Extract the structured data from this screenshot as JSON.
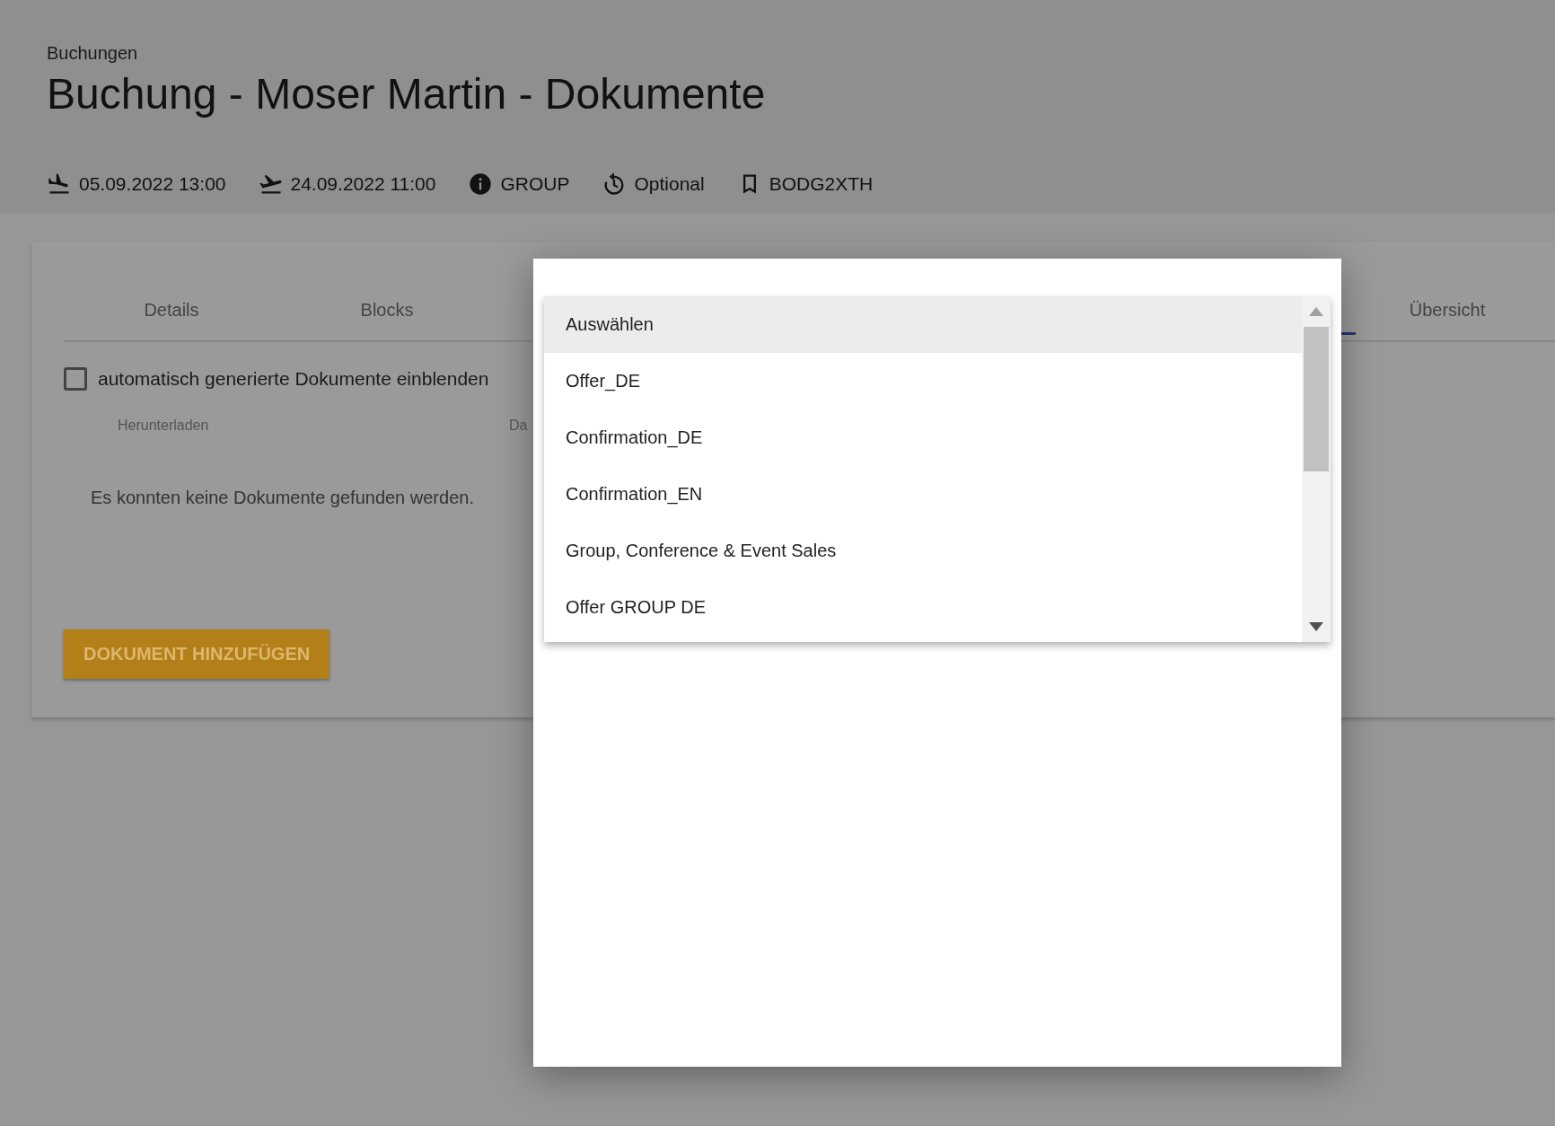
{
  "breadcrumb": "Buchungen",
  "title": "Buchung -  Moser Martin - Dokumente",
  "meta": [
    {
      "kind": "arrival",
      "text": "05.09.2022 13:00"
    },
    {
      "kind": "departure",
      "text": "24.09.2022 11:00"
    },
    {
      "kind": "info",
      "text": "GROUP"
    },
    {
      "kind": "status",
      "text": "Optional"
    },
    {
      "kind": "bookmark",
      "text": "BODG2XTH"
    }
  ],
  "tabs": [
    {
      "label": "Details",
      "selected": false
    },
    {
      "label": "Blocks",
      "selected": false
    },
    {
      "label": "Übersicht",
      "selected": false
    }
  ],
  "auto_docs_checkbox": {
    "label": "automatisch generierte Dokumente einblenden",
    "checked": false
  },
  "table": {
    "columns": [
      "Herunterladen",
      "Da"
    ],
    "empty_message": "Es konnten keine Dokumente gefunden werden."
  },
  "add_button": "DOKUMENT HINZUFÜGEN",
  "template_dropdown": {
    "options": [
      {
        "label": "Auswählen",
        "selected": true
      },
      {
        "label": "Offer_DE",
        "selected": false
      },
      {
        "label": "Confirmation_DE",
        "selected": false
      },
      {
        "label": "Confirmation_EN",
        "selected": false
      },
      {
        "label": "Group, Conference & Event Sales",
        "selected": false
      },
      {
        "label": "Offer GROUP DE",
        "selected": false
      }
    ]
  }
}
